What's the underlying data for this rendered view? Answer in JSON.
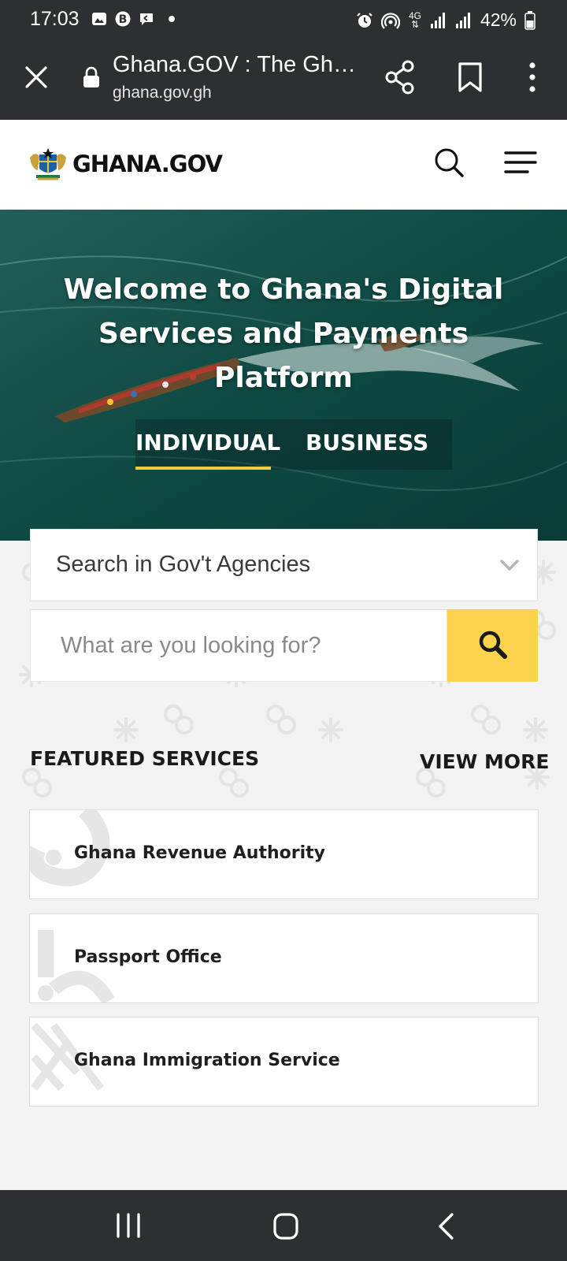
{
  "status_bar": {
    "time": "17:03",
    "network": "4G",
    "battery": "42%",
    "icons": [
      "gallery-icon",
      "b-app-icon",
      "message-icon",
      "dot-icon",
      "alarm-icon",
      "hotspot-icon",
      "data-arrows-icon",
      "signal-icon",
      "signal-icon",
      "battery-icon"
    ]
  },
  "browser": {
    "title": "Ghana.GOV : The Gh…",
    "url": "ghana.gov.gh",
    "icons": [
      "close-icon",
      "lock-icon",
      "share-icon",
      "bookmark-icon",
      "more-vert-icon"
    ]
  },
  "header": {
    "logo_text": "GHANA.GOV",
    "icons": [
      "coat-of-arms-emblem",
      "search-icon",
      "menu-icon"
    ]
  },
  "hero": {
    "title": "Welcome to Ghana's Digital Services and Payments Platform",
    "tabs": [
      {
        "label": "INDIVIDUAL",
        "active": true
      },
      {
        "label": "BUSINESS",
        "active": false
      }
    ]
  },
  "search": {
    "agency_select_label": "Search in Gov't Agencies",
    "placeholder": "What are you looking for?",
    "icons": [
      "chevron-down-icon",
      "search-icon"
    ]
  },
  "featured": {
    "heading": "FEATURED SERVICES",
    "view_more": "VIEW MORE",
    "services": [
      {
        "label": "Ghana Revenue Authority"
      },
      {
        "label": "Passport Office"
      },
      {
        "label": "Ghana Immigration Service"
      }
    ]
  },
  "colors": {
    "accent_yellow": "#fcd34d",
    "dark_bar": "#2e2f33",
    "hero_sea": "#0f4842"
  }
}
